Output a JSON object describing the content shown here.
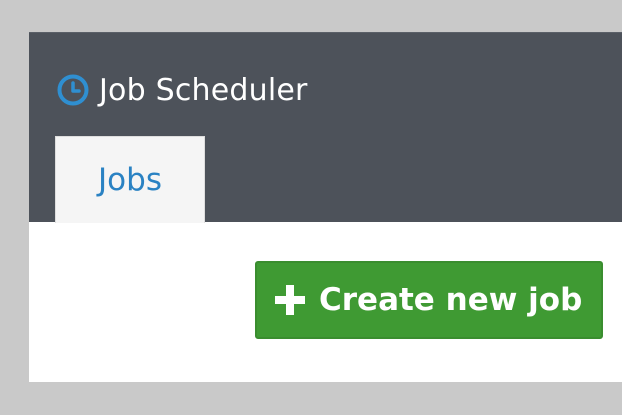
{
  "app": {
    "title": "Job Scheduler",
    "icon": "clock-icon",
    "header_color": "#4d525a",
    "accent": "#2a82c3"
  },
  "tabs": [
    {
      "label": "Jobs",
      "active": true
    }
  ],
  "actions": {
    "create_job": {
      "label": "Create new job",
      "icon": "plus-icon",
      "color": "#3f9a33"
    }
  }
}
